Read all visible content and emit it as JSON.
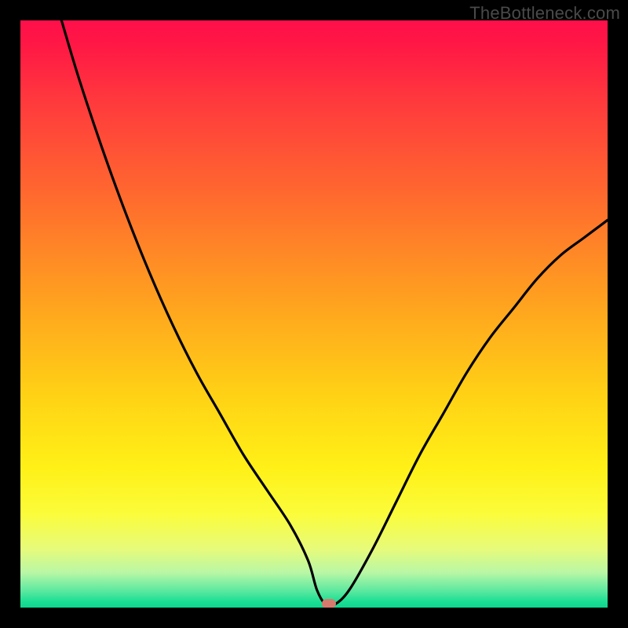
{
  "watermark": "TheBottleneck.com",
  "chart_data": {
    "type": "line",
    "title": "",
    "xlabel": "",
    "ylabel": "",
    "xlim": [
      0,
      100
    ],
    "ylim": [
      0,
      100
    ],
    "grid": false,
    "legend": false,
    "series": [
      {
        "name": "curve",
        "x": [
          7,
          10,
          14,
          18,
          22,
          26,
          30,
          34,
          38,
          42,
          46,
          49,
          50.5,
          52,
          53.5,
          56,
          60,
          64,
          68,
          72,
          76,
          80,
          84,
          88,
          92,
          96,
          100
        ],
        "y": [
          100,
          90,
          78,
          67,
          57,
          48,
          40,
          33,
          26,
          20,
          14,
          8,
          3,
          0.5,
          0.5,
          3,
          10,
          18,
          26,
          33,
          40,
          46,
          51,
          56,
          60,
          63,
          66
        ]
      }
    ],
    "marker": {
      "x": 52.5,
      "y": 0.7,
      "color": "#d77a6e"
    },
    "colors": {
      "curve": "#000000",
      "background_top": "#ff0f4a",
      "background_bottom": "#0fd58e",
      "frame": "#000000"
    }
  }
}
